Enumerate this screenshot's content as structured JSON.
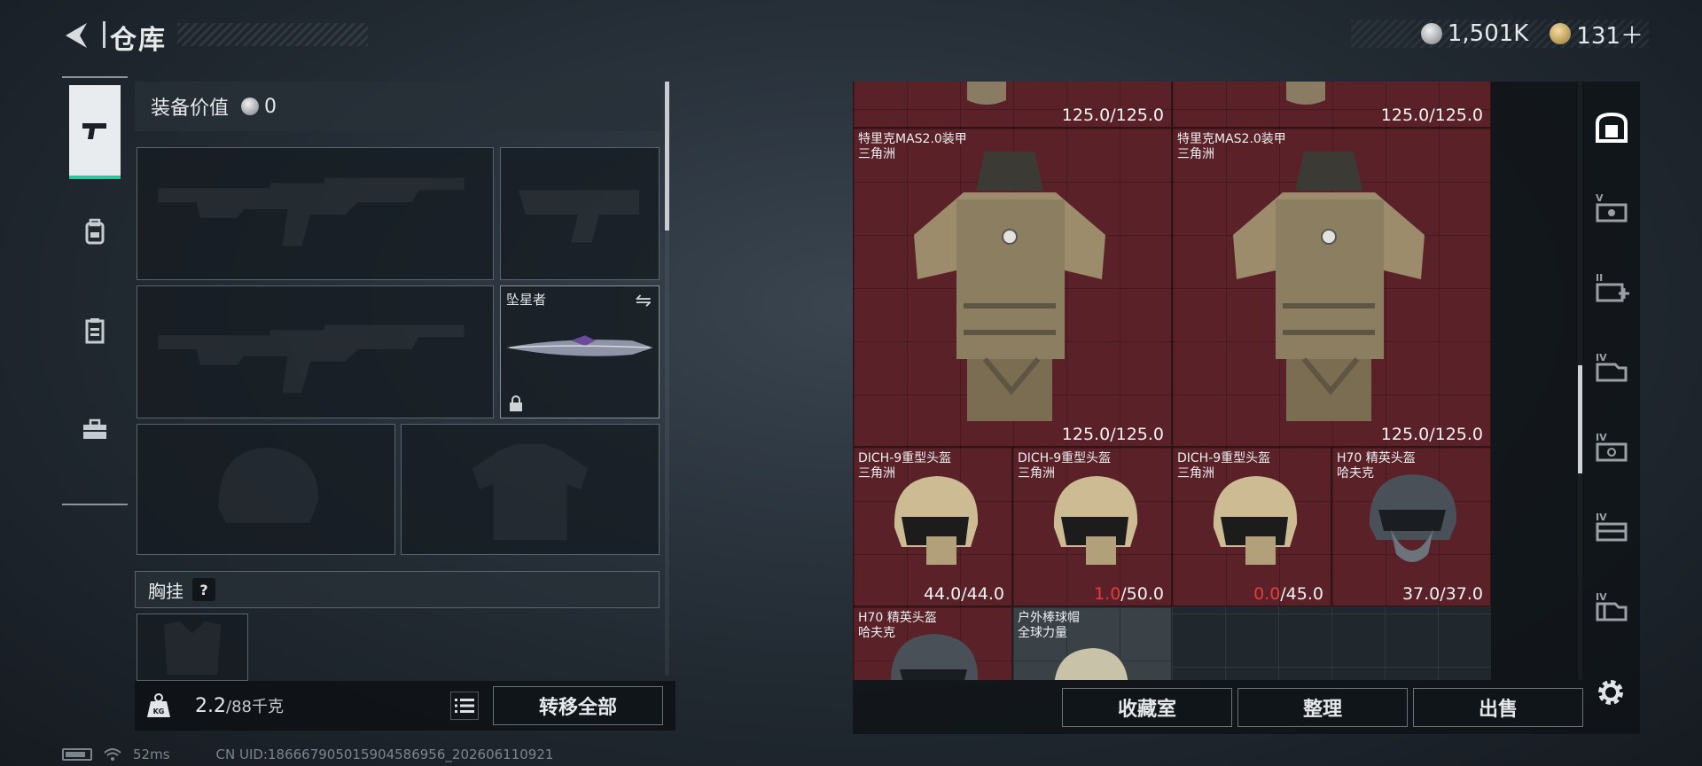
{
  "header": {
    "title": "仓库",
    "currencies": [
      {
        "icon": "silver-coin-icon",
        "value": "1,501K"
      },
      {
        "icon": "gold-coin-icon",
        "value": "131＋"
      }
    ]
  },
  "side_tabs": [
    {
      "name": "weapons",
      "icon": "pistol-icon",
      "active": true
    },
    {
      "name": "backpack",
      "icon": "backpack-icon",
      "active": false
    },
    {
      "name": "chest-rig",
      "icon": "clipboard-icon",
      "active": false
    },
    {
      "name": "items",
      "icon": "toolbox-icon",
      "active": false
    }
  ],
  "loadout": {
    "value_label": "装备价值",
    "value": "0",
    "melee_name": "坠星者",
    "chest_rig_label": "胸挂",
    "help": "?",
    "weight_current": "2.2",
    "weight_max": "/88千克",
    "transfer_all": "转移全部"
  },
  "storage": {
    "items": [
      {
        "name": "",
        "sub": "",
        "cur": "125.0",
        "max": "/125.0",
        "cur_red": false
      },
      {
        "name": "",
        "sub": "",
        "cur": "125.0",
        "max": "/125.0",
        "cur_red": false
      },
      {
        "name": "特里克MAS2.0装甲",
        "sub": "三角洲",
        "cur": "125.0",
        "max": "/125.0",
        "cur_red": false
      },
      {
        "name": "特里克MAS2.0装甲",
        "sub": "三角洲",
        "cur": "125.0",
        "max": "/125.0",
        "cur_red": false
      },
      {
        "name": "DICH-9重型头盔",
        "sub": "三角洲",
        "cur": "44.0",
        "max": "/44.0",
        "cur_red": false
      },
      {
        "name": "DICH-9重型头盔",
        "sub": "三角洲",
        "cur": "1.0",
        "max": "/50.0",
        "cur_red": true
      },
      {
        "name": "DICH-9重型头盔",
        "sub": "三角洲",
        "cur": "0.0",
        "max": "/45.0",
        "cur_red": true
      },
      {
        "name": "H70 精英头盔",
        "sub": "哈夫克",
        "cur": "37.0",
        "max": "/37.0",
        "cur_red": false
      },
      {
        "name": "H70 精英头盔",
        "sub": "哈夫克",
        "cur": "",
        "max": "",
        "cur_red": false
      },
      {
        "name": "户外棒球帽",
        "sub": "全球力量",
        "cur": "",
        "max": "",
        "cur_red": false
      }
    ],
    "buttons": {
      "collection": "收藏室",
      "organize": "整理",
      "sell": "出售"
    }
  },
  "right_tabs": [
    "safe-icon",
    "v-container-icon",
    "ii-medkit-icon",
    "iv-container-icon",
    "iv-case-icon",
    "iv-box-icon",
    "iv-crate-icon"
  ],
  "status": {
    "ping": "52ms",
    "uid": "CN UID:1866679050159045869​56_202606110921"
  },
  "colors": {
    "accent": "#2ec4a0",
    "damaged": "#e53c3c",
    "item_bg": "#5a2228"
  }
}
